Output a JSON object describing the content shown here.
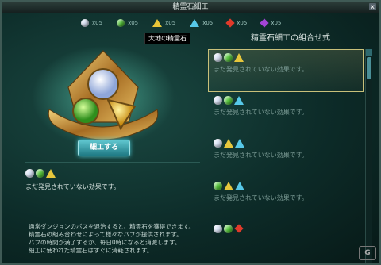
{
  "window": {
    "title": "精霊石細工",
    "close_label": "x"
  },
  "gem_bar": [
    {
      "name": "white-gem",
      "color": "#dbe4f7",
      "shape": "circle",
      "count": "x05"
    },
    {
      "name": "green-gem",
      "color": "#54c63a",
      "shape": "circle",
      "count": "x05"
    },
    {
      "name": "yellow-gem",
      "color": "#e8c538",
      "shape": "triangle",
      "count": "x05"
    },
    {
      "name": "blue-gem",
      "color": "#57c8e8",
      "shape": "triangle",
      "count": "x05"
    },
    {
      "name": "red-gem",
      "color": "#e03a2a",
      "shape": "diamond",
      "count": "x05"
    },
    {
      "name": "purple-gem",
      "color": "#a344d6",
      "shape": "diamond",
      "count": "x05"
    }
  ],
  "tooltip": "大地の精霊石",
  "craft_button": "細工する",
  "effect": {
    "text": "まだ発見されていない効果です。"
  },
  "info_lines": [
    "通常ダンジョンのボスを退治すると、精霊石を獲得できます。",
    "精霊石の組み合わせによって様々なバフが提供されます。",
    "バフの時間が満了するか、毎日0時になると消滅します。",
    "細工に使われた精霊石はすぐに消耗されます。"
  ],
  "right_panel": {
    "title": "精霊石細工の組合せ式"
  },
  "combos": [
    {
      "icons": [
        "white",
        "green",
        "yellow"
      ],
      "text": "まだ発見されていない効果です。",
      "selected": true
    },
    {
      "icons": [
        "white",
        "green",
        "blue"
      ],
      "text": "まだ発見されていない効果です。",
      "selected": false
    },
    {
      "icons": [
        "white",
        "yellow",
        "blue"
      ],
      "text": "まだ発見されていない効果です。",
      "selected": false
    },
    {
      "icons": [
        "green",
        "yellow",
        "blue"
      ],
      "text": "まだ発見されていない効果です。",
      "selected": false
    },
    {
      "icons": [
        "white",
        "green",
        "red"
      ],
      "text": "",
      "selected": false
    }
  ],
  "colors": {
    "white": "#dbe4f7",
    "green": "#54c63a",
    "yellow": "#e6c63c",
    "blue": "#57c8e8",
    "red": "#e03a2a",
    "purple": "#a344d6",
    "accent": "#5fc6cf"
  },
  "watermark": "G"
}
